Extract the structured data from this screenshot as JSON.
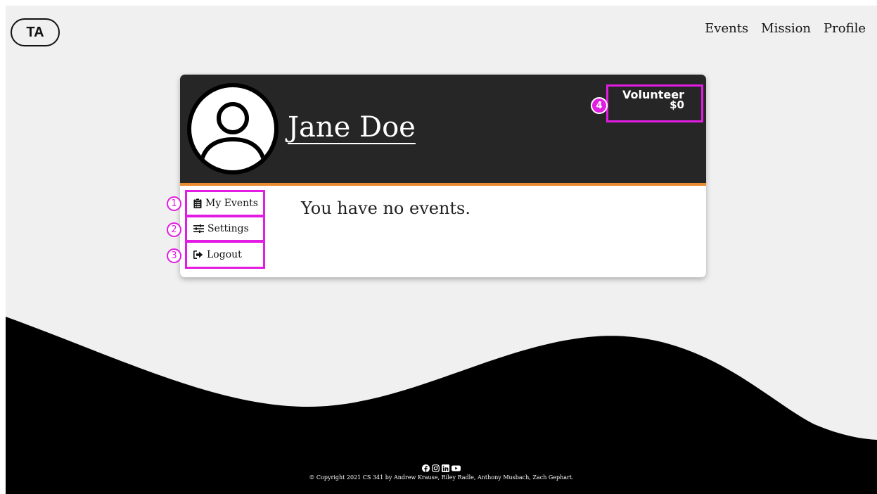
{
  "header": {
    "logo_text": "TA",
    "nav": [
      "Events",
      "Mission",
      "Profile"
    ]
  },
  "profile": {
    "name": "Jane Doe",
    "role": "Volunteer",
    "amount": "$0"
  },
  "sidebar": {
    "items": [
      {
        "label": "My Events",
        "icon": "clipboard-list-icon",
        "annotation": "1"
      },
      {
        "label": "Settings",
        "icon": "sliders-icon",
        "annotation": "2"
      },
      {
        "label": "Logout",
        "icon": "sign-out-icon",
        "annotation": "3"
      }
    ]
  },
  "main": {
    "empty_message": "You have no events."
  },
  "role_annotation": "4",
  "footer": {
    "social_icons": [
      "facebook-icon",
      "instagram-icon",
      "linkedin-icon",
      "youtube-icon"
    ],
    "copyright": "© Copyright 2021 CS 341 by Andrew Krause, Riley Radle, Anthony Musbach, Zach Gephart."
  },
  "colors": {
    "header_bg": "#262626",
    "accent_orange": "#e88a2e",
    "annotation_magenta": "#e31ce3",
    "page_bg": "#f0f0f0"
  }
}
